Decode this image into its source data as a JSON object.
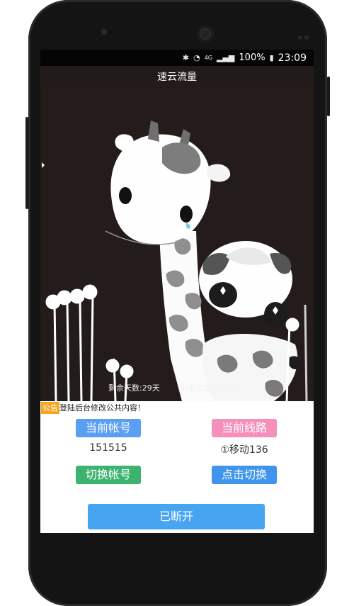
{
  "status_bar": {
    "bluetooth_icon": "bluetooth-icon",
    "wifi_icon": "wifi-icon",
    "network_label": "4G",
    "battery_percent": "100%",
    "time": "23:09"
  },
  "app": {
    "title": "速云流量"
  },
  "stats": {
    "days_left": "剩余天数:29天",
    "flow_left": "剩余流量14.1GB"
  },
  "notice": {
    "tag": "公告",
    "text": "登陆后台修改公共内容！"
  },
  "account": {
    "label": "当前帐号",
    "value": "151515",
    "switch_label": "切换帐号"
  },
  "route": {
    "label": "当前线路",
    "value": "①移动136",
    "switch_label": "点击切换"
  },
  "connect": {
    "label": "已断开"
  },
  "colors": {
    "account_label_bg": "#5b9ff5",
    "route_label_bg": "#f68fbd",
    "switch_account_bg": "#3cb46f",
    "switch_route_bg": "#3f95ec",
    "connect_bg": "#46a4f0",
    "notice_tag_bg": "#f5a623",
    "hero_bg": "#241c1b"
  }
}
